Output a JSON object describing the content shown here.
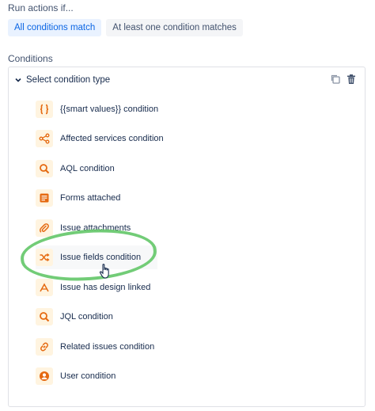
{
  "header": {
    "run_label": "Run actions if...",
    "options": [
      {
        "label": "All conditions match",
        "active": true
      },
      {
        "label": "At least one condition matches",
        "active": false
      }
    ]
  },
  "conditions": {
    "section_label": "Conditions",
    "select_label": "Select condition type",
    "items": [
      {
        "label": "{{smart values}} condition",
        "icon": "braces-icon"
      },
      {
        "label": "Affected services condition",
        "icon": "services-icon"
      },
      {
        "label": "AQL condition",
        "icon": "search-icon"
      },
      {
        "label": "Forms attached",
        "icon": "form-icon"
      },
      {
        "label": "Issue attachments",
        "icon": "paperclip-icon"
      },
      {
        "label": "Issue fields condition",
        "icon": "shuffle-icon"
      },
      {
        "label": "Issue has design linked",
        "icon": "design-icon"
      },
      {
        "label": "JQL condition",
        "icon": "search-icon"
      },
      {
        "label": "Related issues condition",
        "icon": "link-icon"
      },
      {
        "label": "User condition",
        "icon": "user-icon"
      }
    ]
  },
  "colors": {
    "accent": "#0C66E4",
    "icon_orange": "#E56910",
    "icon_bg": "#FFF4E0",
    "highlight_green": "#63C768"
  }
}
